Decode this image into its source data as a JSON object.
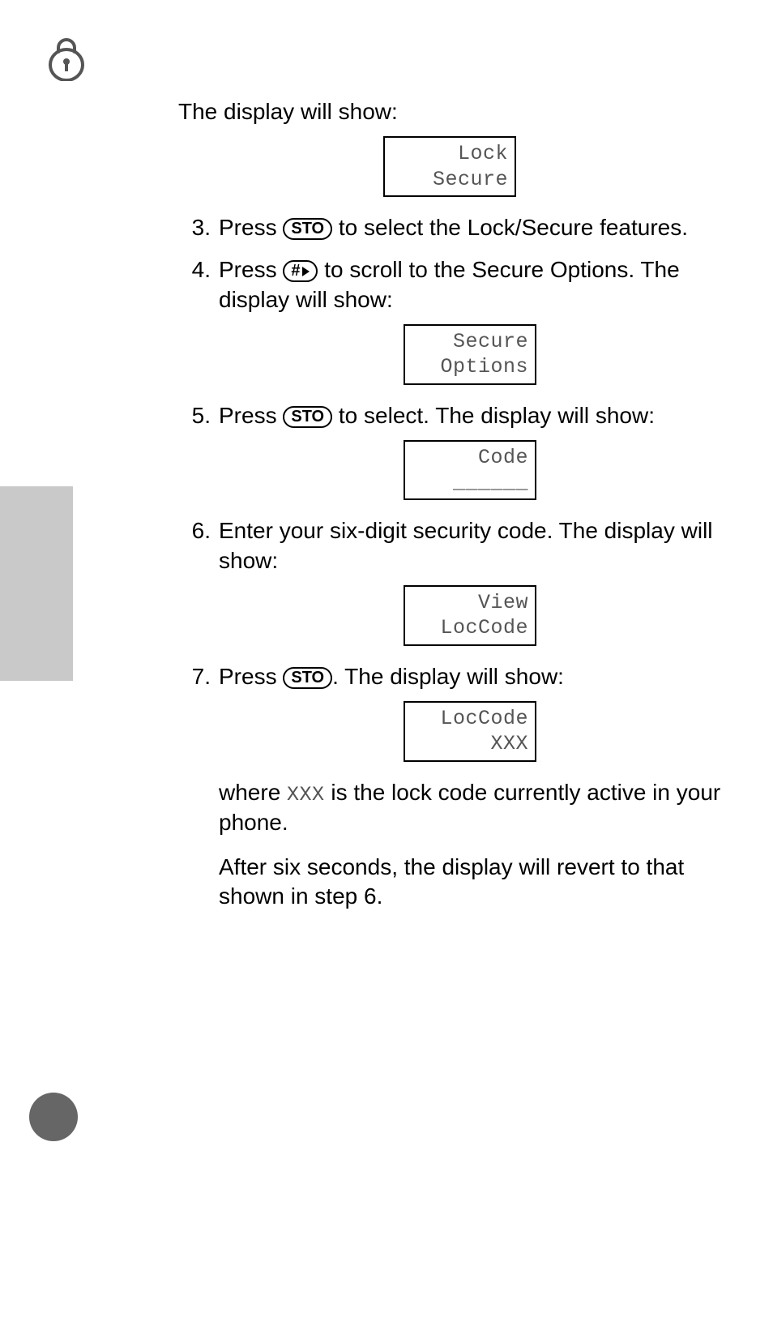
{
  "intro": "The display will show:",
  "displays": {
    "d1": {
      "l1": "Lock",
      "l2": "Secure"
    },
    "d2": {
      "l1": "Secure",
      "l2": "Options"
    },
    "d3": {
      "l1": "Code",
      "l2": "______"
    },
    "d4": {
      "l1": "View",
      "l2": "LocCode"
    },
    "d5": {
      "l1": "LocCode",
      "l2": "XXX"
    }
  },
  "keys": {
    "sto": "STO",
    "hash": "#"
  },
  "steps": {
    "s3": {
      "num": "3.",
      "t1": "Press ",
      "t2": " to select the Lock/Secure features."
    },
    "s4": {
      "num": "4.",
      "t1": "Press ",
      "t2": " to scroll to the Secure Options. The display will show:"
    },
    "s5": {
      "num": "5.",
      "t1": "Press ",
      "t2": " to select. The display will show:"
    },
    "s6": {
      "num": "6.",
      "t1": "Enter your six-digit security code. The display will show:"
    },
    "s7": {
      "num": "7.",
      "t1": "Press ",
      "t2": ". The display will show:"
    }
  },
  "tail": {
    "where_before": "where ",
    "xxx": "XXX",
    "where_after": " is the lock code currently active in your phone.",
    "after": "After six seconds, the display will revert to that shown in step 6."
  }
}
